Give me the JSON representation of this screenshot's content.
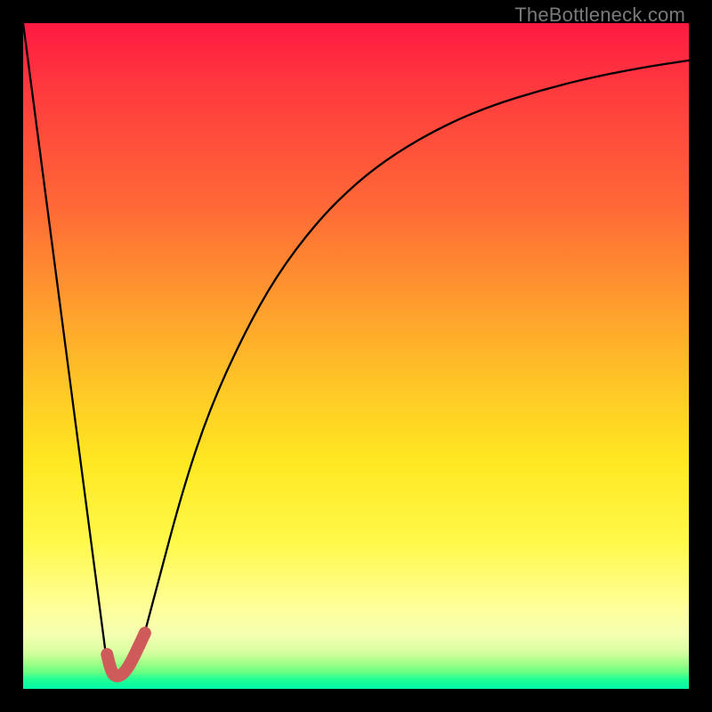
{
  "watermark": {
    "text": "TheBottleneck.com"
  },
  "colors": {
    "background_outer": "#000000",
    "curve_black": "#000000",
    "highlight_stroke": "#cf5a5a",
    "gradient_stops": [
      "#ff1a42",
      "#ff6a36",
      "#ffc826",
      "#fff94a",
      "#ffff9c",
      "#6bff84",
      "#00f7a8"
    ]
  },
  "chart_data": {
    "type": "line",
    "title": "",
    "xlabel": "",
    "ylabel": "",
    "xlim": [
      0,
      100
    ],
    "ylim": [
      0,
      100
    ],
    "grid": false,
    "legend": false,
    "series": [
      {
        "name": "left-slope",
        "x": [
          0,
          12.8
        ],
        "values": [
          100,
          2.3
        ]
      },
      {
        "name": "valley-hook",
        "x": [
          12.8,
          13.6,
          15.0,
          16.4,
          18.2
        ],
        "values": [
          2.3,
          1.7,
          1.9,
          3.4,
          8.2
        ]
      },
      {
        "name": "rising-curve",
        "x": [
          18.2,
          20,
          24,
          28,
          33,
          38,
          44,
          50,
          56,
          63,
          70,
          78,
          86,
          94,
          100
        ],
        "values": [
          8.2,
          15,
          30,
          42,
          53,
          62,
          70,
          76,
          80.5,
          84.5,
          87.5,
          90,
          92,
          93.5,
          94.4
        ]
      }
    ],
    "highlight": {
      "name": "highlighted-hook",
      "x": [
        12.6,
        13.2,
        14.0,
        15.0,
        16.0,
        17.0,
        18.3
      ],
      "values": [
        5.2,
        2.5,
        1.8,
        2.2,
        3.6,
        5.6,
        8.4
      ]
    }
  }
}
